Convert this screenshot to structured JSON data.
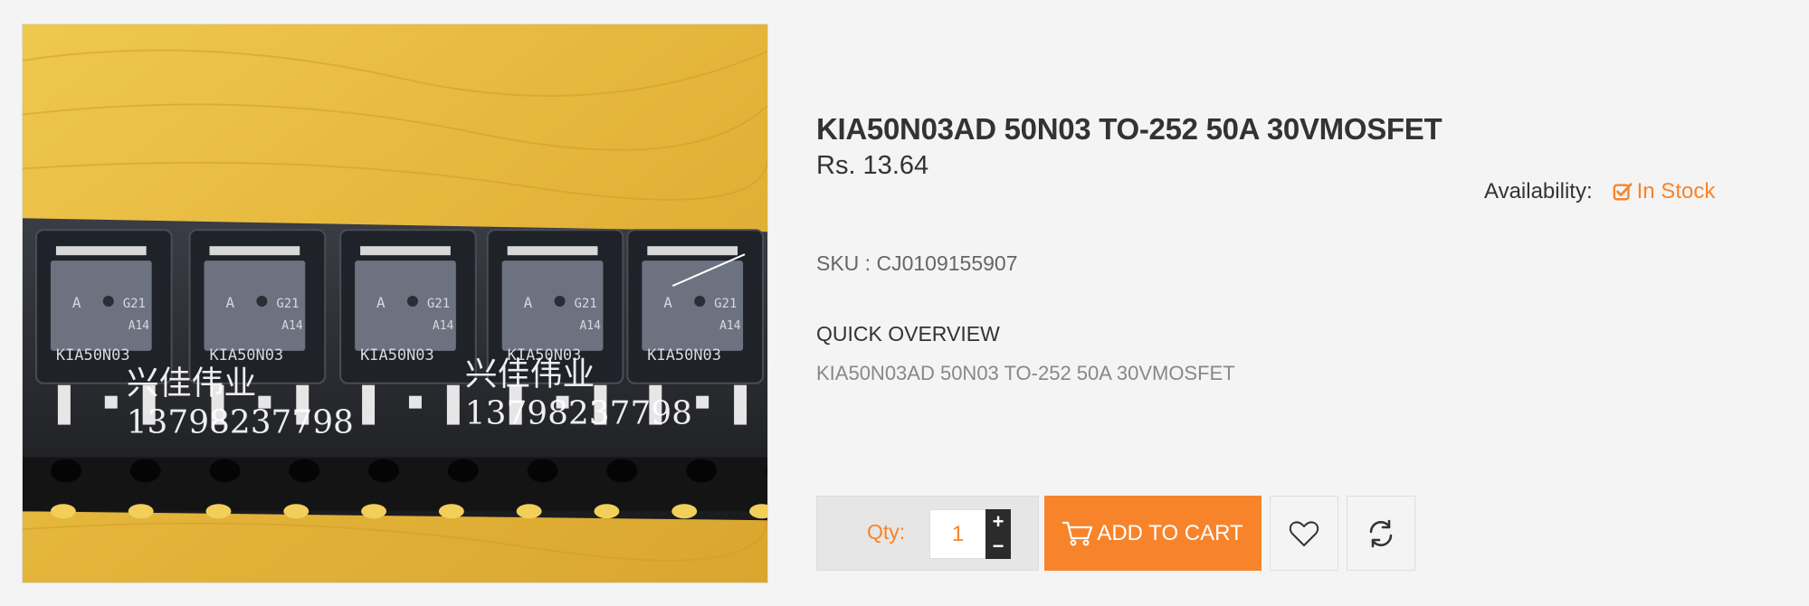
{
  "product": {
    "title": "KIA50N03AD 50N03 TO-252 50A 30VMOSFET",
    "price": "Rs. 13.64",
    "availability_label": "Availability:",
    "stock_status": "In Stock",
    "sku": "SKU : CJ0109155907",
    "overview_heading": "QUICK OVERVIEW",
    "overview_text": "KIA50N03AD 50N03 TO-252 50A 30VMOSFET"
  },
  "image": {
    "chip_markings": [
      "A",
      "G21",
      "A14",
      "KIA50N03"
    ],
    "watermark_name": "兴佳伟业",
    "watermark_phone": "13798237798"
  },
  "purchase": {
    "qty_label": "Qty:",
    "qty_value": "1",
    "increment_symbol": "+",
    "decrement_symbol": "−",
    "add_to_cart_label": "ADD TO CART"
  },
  "colors": {
    "accent": "#f7842b",
    "text": "#333333",
    "muted": "#888888",
    "background": "#f4f4f4"
  },
  "icons": {
    "stock": "check-square-icon",
    "cart": "cart-icon",
    "wishlist": "heart-icon",
    "compare": "refresh-icon",
    "plus": "plus-icon",
    "minus": "minus-icon"
  }
}
